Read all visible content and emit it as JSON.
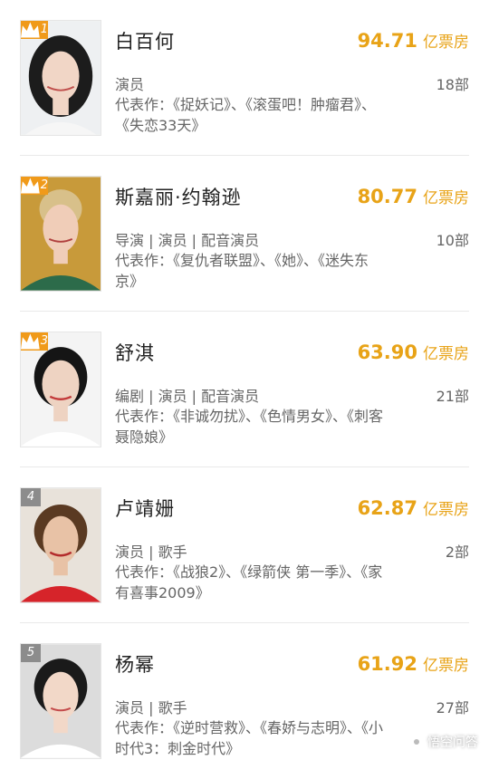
{
  "colors": {
    "accent": "#e8a317",
    "rank_top": "#f09a1a",
    "rank_plain": "#8c8c8c"
  },
  "box_unit": "亿票房",
  "items": [
    {
      "rank": "1",
      "name": "白百何",
      "box_office": "94.71",
      "roles": "演员",
      "count": "18部",
      "works": "代表作：《捉妖记》、《滚蛋吧！肿瘤君》、《失恋33天》"
    },
    {
      "rank": "2",
      "name": "斯嘉丽·约翰逊",
      "box_office": "80.77",
      "roles": "导演 | 演员 | 配音演员",
      "count": "10部",
      "works": "代表作：《复仇者联盟》、《她》、《迷失东京》"
    },
    {
      "rank": "3",
      "name": "舒淇",
      "box_office": "63.90",
      "roles": "编剧 | 演员 | 配音演员",
      "count": "21部",
      "works": "代表作：《非诚勿扰》、《色情男女》、《刺客聂隐娘》"
    },
    {
      "rank": "4",
      "name": "卢靖姗",
      "box_office": "62.87",
      "roles": "演员 | 歌手",
      "count": "2部",
      "works": "代表作：《战狼2》、《绿箭侠 第一季》、《家有喜事2009》"
    },
    {
      "rank": "5",
      "name": "杨幂",
      "box_office": "61.92",
      "roles": "演员 | 歌手",
      "count": "27部",
      "works": "代表作：《逆时营救》、《春娇与志明》、《小时代3：刺金时代》"
    }
  ],
  "watermark": "悟空问答"
}
